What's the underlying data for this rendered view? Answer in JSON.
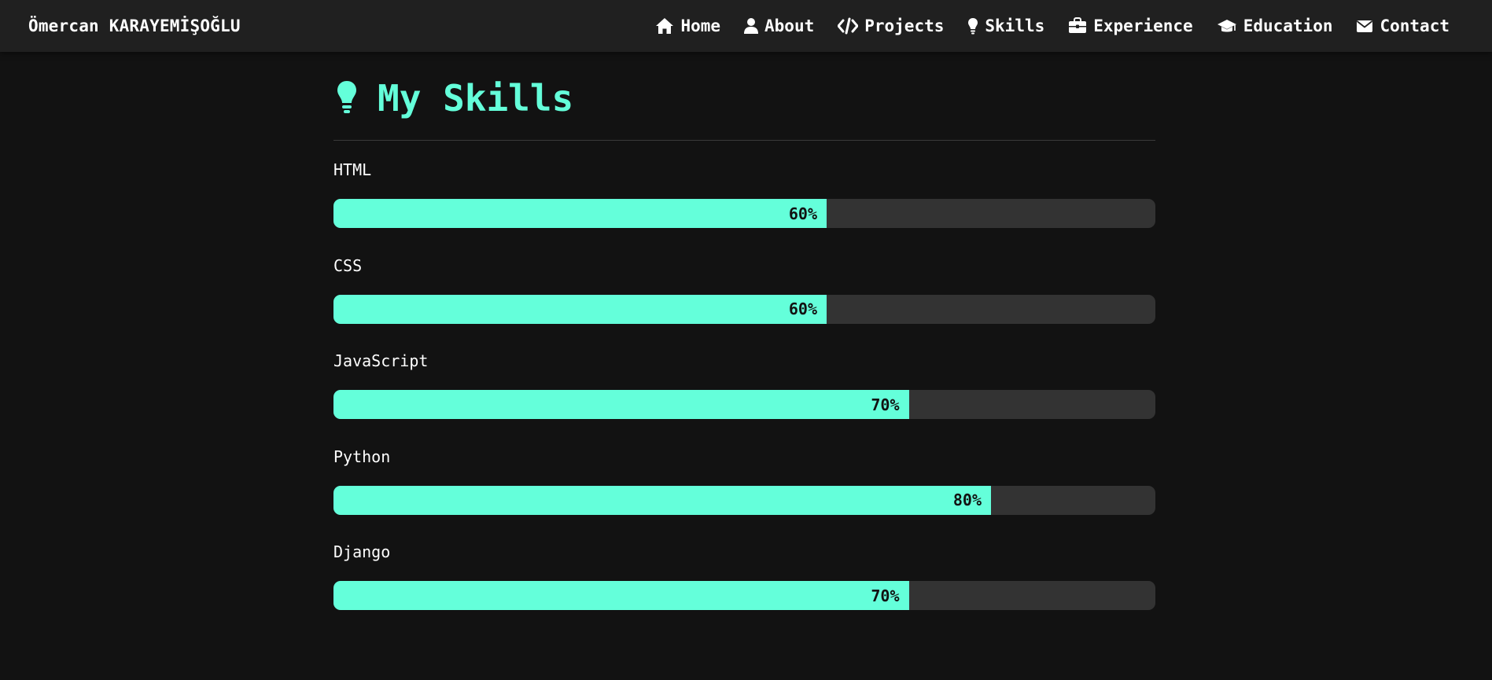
{
  "nav": {
    "brand": "Ömercan KARAYEMİŞOĞLU",
    "links": [
      {
        "label": "Home",
        "icon": "home-icon"
      },
      {
        "label": "About",
        "icon": "user-icon"
      },
      {
        "label": "Projects",
        "icon": "code-icon"
      },
      {
        "label": "Skills",
        "icon": "lightbulb-icon"
      },
      {
        "label": "Experience",
        "icon": "briefcase-icon"
      },
      {
        "label": "Education",
        "icon": "graduation-cap-icon"
      },
      {
        "label": "Contact",
        "icon": "envelope-icon"
      }
    ]
  },
  "main": {
    "title": "My Skills",
    "title_icon": "lightbulb-icon",
    "skills": [
      {
        "name": "HTML",
        "percent": 60,
        "label": "60%"
      },
      {
        "name": "CSS",
        "percent": 60,
        "label": "60%"
      },
      {
        "name": "JavaScript",
        "percent": 70,
        "label": "70%"
      },
      {
        "name": "Python",
        "percent": 80,
        "label": "80%"
      },
      {
        "name": "Django",
        "percent": 70,
        "label": "70%"
      }
    ]
  },
  "colors": {
    "accent": "#64ffda",
    "background": "#121212",
    "navbar": "#202020",
    "track": "#333333"
  }
}
